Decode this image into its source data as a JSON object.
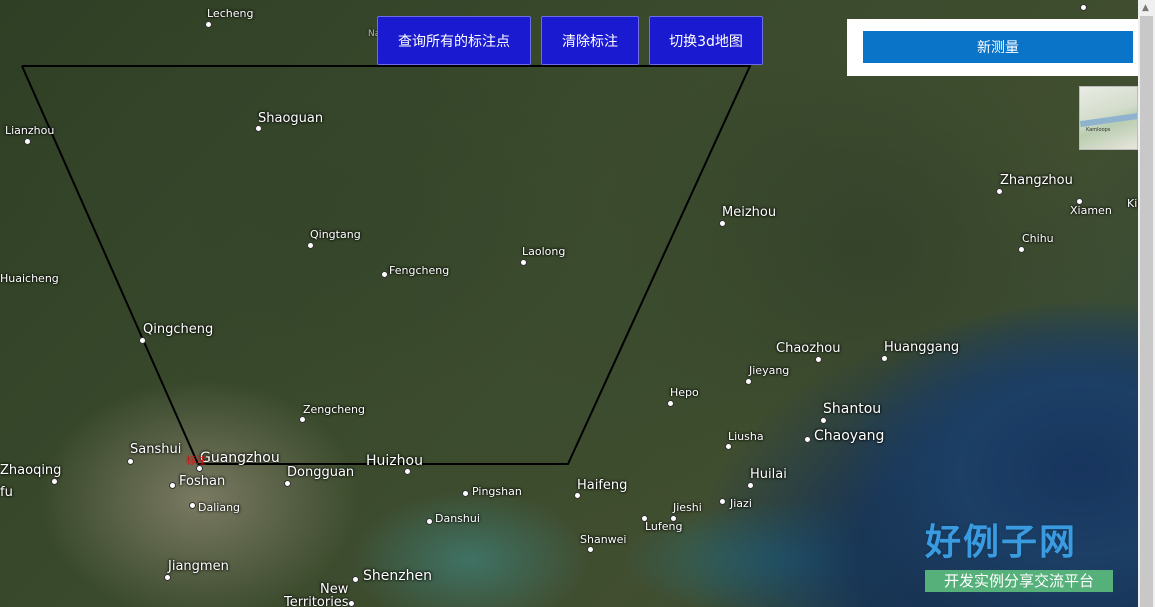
{
  "toolbar": {
    "query_markers_label": "查询所有的标注点",
    "clear_markers_label": "清除标注",
    "toggle_3d_label": "切换3d地图"
  },
  "panel": {
    "new_measure_label": "新测量"
  },
  "marker": {
    "label": "标注"
  },
  "places": [
    {
      "name": "Lecheng"
    },
    {
      "name": "Shaoguan"
    },
    {
      "name": "Lianzhou"
    },
    {
      "name": "Qingtang"
    },
    {
      "name": "Fengcheng"
    },
    {
      "name": "Laolong"
    },
    {
      "name": "Meizhou"
    },
    {
      "name": "Huaicheng"
    },
    {
      "name": "Qingcheng"
    },
    {
      "name": "Zhangzhou"
    },
    {
      "name": "Xiamen"
    },
    {
      "name": "Chihu"
    },
    {
      "name": "Chaozhou"
    },
    {
      "name": "Huanggang"
    },
    {
      "name": "Jieyang"
    },
    {
      "name": "Hepo"
    },
    {
      "name": "Shantou"
    },
    {
      "name": "Chaoyang"
    },
    {
      "name": "Zengcheng"
    },
    {
      "name": "Liusha"
    },
    {
      "name": "Sanshui"
    },
    {
      "name": "Guangzhou"
    },
    {
      "name": "Dongguan"
    },
    {
      "name": "Huizhou"
    },
    {
      "name": "Zhaoqing"
    },
    {
      "name": "Foshan"
    },
    {
      "name": "Pingshan"
    },
    {
      "name": "Haifeng"
    },
    {
      "name": "Huilai"
    },
    {
      "name": "Jiazi"
    },
    {
      "name": "Jieshi"
    },
    {
      "name": "Lufeng"
    },
    {
      "name": "Daliang"
    },
    {
      "name": "Danshui"
    },
    {
      "name": "Shanwei"
    },
    {
      "name": "Jiangmen"
    },
    {
      "name": "Shenzhen"
    },
    {
      "name": "New"
    },
    {
      "name": "Territories"
    },
    {
      "name": "fu"
    },
    {
      "name": "Nanxiong"
    },
    {
      "name": "Kin"
    }
  ],
  "watermark": {
    "main": "好例子网",
    "sub": "开发实例分享交流平台"
  },
  "minimap": {
    "label": "Kamloops"
  },
  "colors": {
    "button_bg": "#1a1ad0",
    "panel_button_bg": "#0a74c9",
    "measure_line": "#000000",
    "marker_text": "#d01010"
  }
}
